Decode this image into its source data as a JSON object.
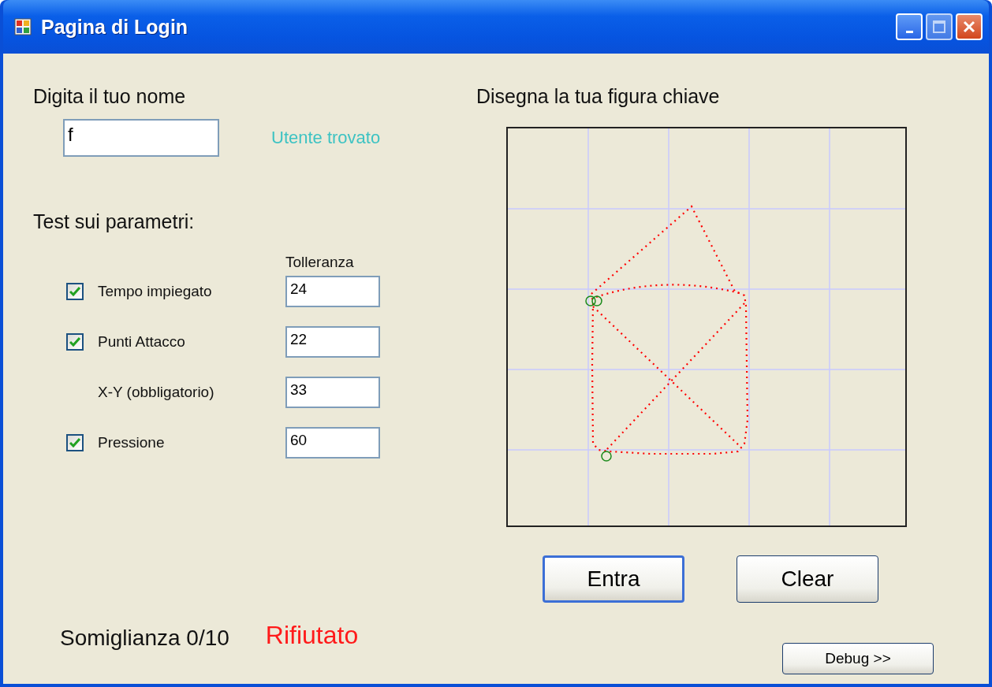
{
  "window": {
    "title": "Pagina di Login"
  },
  "name_section": {
    "label": "Digita il tuo nome",
    "input": {
      "value": "f"
    },
    "status": "Utente trovato"
  },
  "parameters": {
    "title": "Test sui parametri:",
    "tolerance_header": "Tolleranza",
    "rows": [
      {
        "kind": "checkbox",
        "label": "Tempo impiegato",
        "checked": true,
        "tolerance": "24"
      },
      {
        "kind": "checkbox",
        "label": "Punti Attacco",
        "checked": true,
        "tolerance": "22"
      },
      {
        "kind": "fixed",
        "label": "X-Y (obbligatorio)",
        "tolerance": "33"
      },
      {
        "kind": "checkbox",
        "label": "Pressione",
        "checked": true,
        "tolerance": "60"
      }
    ]
  },
  "result": {
    "similarity": "Somiglianza 0/10",
    "verdict": "Rifiutato"
  },
  "drawing": {
    "label": "Disegna la tua figura chiave"
  },
  "buttons": [
    {
      "label": "Entra",
      "focused": true
    },
    {
      "label": "Clear",
      "focused": false
    }
  ],
  "debug_button": {
    "label": "Debug >>"
  }
}
